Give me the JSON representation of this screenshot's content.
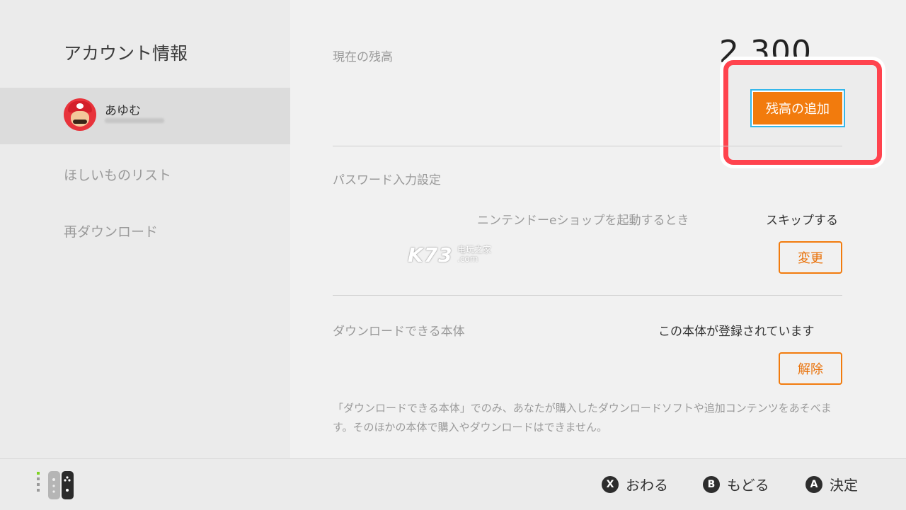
{
  "sidebar": {
    "title": "アカウント情報",
    "user": {
      "name": "あゆむ"
    },
    "items": [
      {
        "label": "ほしいものリスト"
      },
      {
        "label": "再ダウンロード"
      }
    ]
  },
  "balance": {
    "label": "現在の残高",
    "amount": "2,300",
    "add_button": "残高の追加"
  },
  "password": {
    "label": "パスワード入力設定",
    "row_label": "ニンテンドーeショップを起動するとき",
    "row_value": "スキップする",
    "change_button": "変更"
  },
  "download": {
    "label": "ダウンロードできる本体",
    "value": "この本体が登録されています",
    "remove_button": "解除",
    "note": "「ダウンロードできる本体」でのみ、あなたが購入したダウンロードソフトや追加コンテンツをあそべます。そのほかの本体で購入やダウンロードはできません。"
  },
  "watermark": {
    "logo": "K73",
    "cn": "电玩之家",
    "com": ".com"
  },
  "footer": {
    "hints": [
      {
        "button": "X",
        "label": "おわる"
      },
      {
        "button": "B",
        "label": "もどる"
      },
      {
        "button": "A",
        "label": "決定"
      }
    ]
  },
  "colors": {
    "accent_orange": "#f27b0d",
    "focus_cyan": "#35b7ea",
    "highlight_red": "#ff434e"
  },
  "icons": {
    "controller": "joy-con-icon",
    "avatar": "mario-avatar"
  }
}
